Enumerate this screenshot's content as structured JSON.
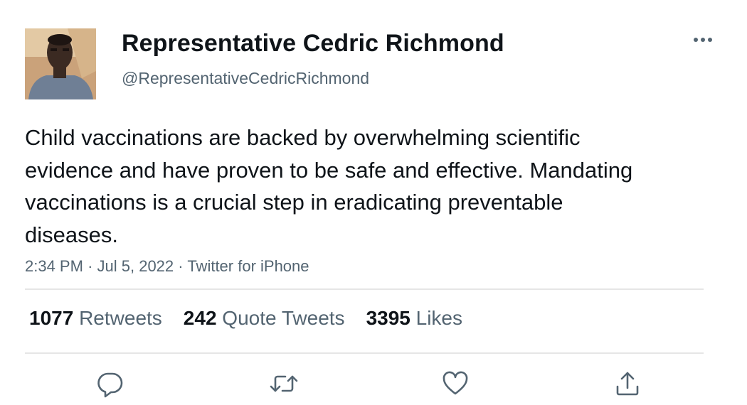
{
  "author": {
    "display_name": "Representative Cedric Richmond",
    "handle": "@RepresentativeCedricRichmond"
  },
  "tweet": {
    "text": "Child vaccinations are backed by overwhelming scientific evidence and have proven to be safe and effective. Mandating vaccinations is a crucial step in eradicating preventable diseases.",
    "time": "2:34 PM",
    "date": "Jul 5, 2022",
    "source": "Twitter for iPhone",
    "separator": "·"
  },
  "stats": {
    "retweets": {
      "count": "1077",
      "label": "Retweets"
    },
    "quotes": {
      "count": "242",
      "label": "Quote Tweets"
    },
    "likes": {
      "count": "3395",
      "label": "Likes"
    }
  },
  "actions": [
    "reply-icon",
    "retweet-icon",
    "like-icon",
    "share-icon"
  ],
  "colors": {
    "text_primary": "#0f1419",
    "text_secondary": "#536471",
    "divider": "#e6e6e6",
    "icon": "#536471"
  }
}
